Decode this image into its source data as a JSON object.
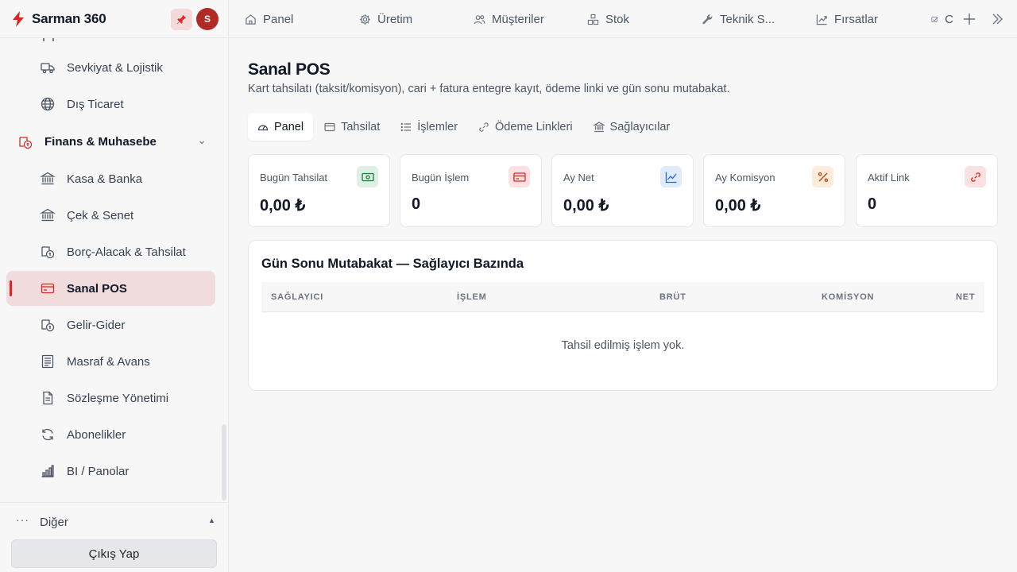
{
  "app": {
    "title": "Sarman 360",
    "avatar_initial": "S"
  },
  "sidebar": {
    "items_top": [
      {
        "label": "Sevkiyat & Lojistik",
        "icon": "truck-icon"
      },
      {
        "label": "Dış Ticaret",
        "icon": "globe-icon"
      }
    ],
    "group": {
      "label": "Finans & Muhasebe",
      "icon": "finance-icon"
    },
    "items": [
      {
        "label": "Kasa & Banka",
        "icon": "bank-icon"
      },
      {
        "label": "Çek & Senet",
        "icon": "bank-icon"
      },
      {
        "label": "Borç-Alacak & Tahsilat",
        "icon": "money-cycle-icon"
      },
      {
        "label": "Sanal POS",
        "icon": "credit-card-icon",
        "active": true
      },
      {
        "label": "Gelir-Gider",
        "icon": "money-cycle-icon"
      },
      {
        "label": "Masraf & Avans",
        "icon": "receipt-icon"
      },
      {
        "label": "Sözleşme Yönetimi",
        "icon": "document-icon"
      },
      {
        "label": "Abonelikler",
        "icon": "refresh-icon"
      },
      {
        "label": "BI / Panolar",
        "icon": "bar-chart-icon"
      }
    ],
    "other_label": "Diğer",
    "logout_label": "Çıkış Yap"
  },
  "topbar": {
    "tabs": [
      {
        "label": "Panel",
        "icon": "home-icon"
      },
      {
        "label": "Üretim",
        "icon": "gear-icon"
      },
      {
        "label": "Müşteriler",
        "icon": "users-icon"
      },
      {
        "label": "Stok",
        "icon": "boxes-icon"
      },
      {
        "label": "Teknik S...",
        "icon": "wrench-icon"
      },
      {
        "label": "Fırsatlar",
        "icon": "trend-icon"
      },
      {
        "label": "C",
        "icon": "checkbox-icon"
      }
    ]
  },
  "page": {
    "title": "Sanal POS",
    "subtitle": "Kart tahsilatı (taksit/komisyon), cari + fatura entegre kayıt, ödeme linki ve gün sonu mutabakat.",
    "subtabs": [
      {
        "label": "Panel",
        "icon": "gauge-icon",
        "active": true
      },
      {
        "label": "Tahsilat",
        "icon": "credit-card-icon"
      },
      {
        "label": "İşlemler",
        "icon": "list-icon"
      },
      {
        "label": "Ödeme Linkleri",
        "icon": "link-icon"
      },
      {
        "label": "Sağlayıcılar",
        "icon": "bank-icon"
      }
    ],
    "stats": [
      {
        "label": "Bugün Tahsilat",
        "value": "0,00 ₺",
        "icon": "cash-icon",
        "color": "#15803d",
        "bg": "#dcf1e3"
      },
      {
        "label": "Bugün İşlem",
        "value": "0",
        "icon": "credit-card-icon",
        "color": "#dc2626",
        "bg": "#fbe1e1"
      },
      {
        "label": "Ay Net",
        "value": "0,00 ₺",
        "icon": "line-chart-icon",
        "color": "#2563eb",
        "bg": "#e0ebfb"
      },
      {
        "label": "Ay Komisyon",
        "value": "0,00 ₺",
        "icon": "percent-icon",
        "color": "#c2410c",
        "bg": "#fdecd9"
      },
      {
        "label": "Aktif Link",
        "value": "0",
        "icon": "link-icon",
        "color": "#dc2626",
        "bg": "#fbe1e1"
      }
    ],
    "reconciliation": {
      "title": "Gün Sonu Mutabakat — Sağlayıcı Bazında",
      "columns": [
        "SAĞLAYICI",
        "İŞLEM",
        "BRÜT",
        "KOMİSYON",
        "NET"
      ],
      "empty_text": "Tahsil edilmiş işlem yok."
    }
  },
  "colors": {
    "accent": "#dc2626",
    "active_bg": "#f1dcdd",
    "avatar": "#b12a25"
  }
}
